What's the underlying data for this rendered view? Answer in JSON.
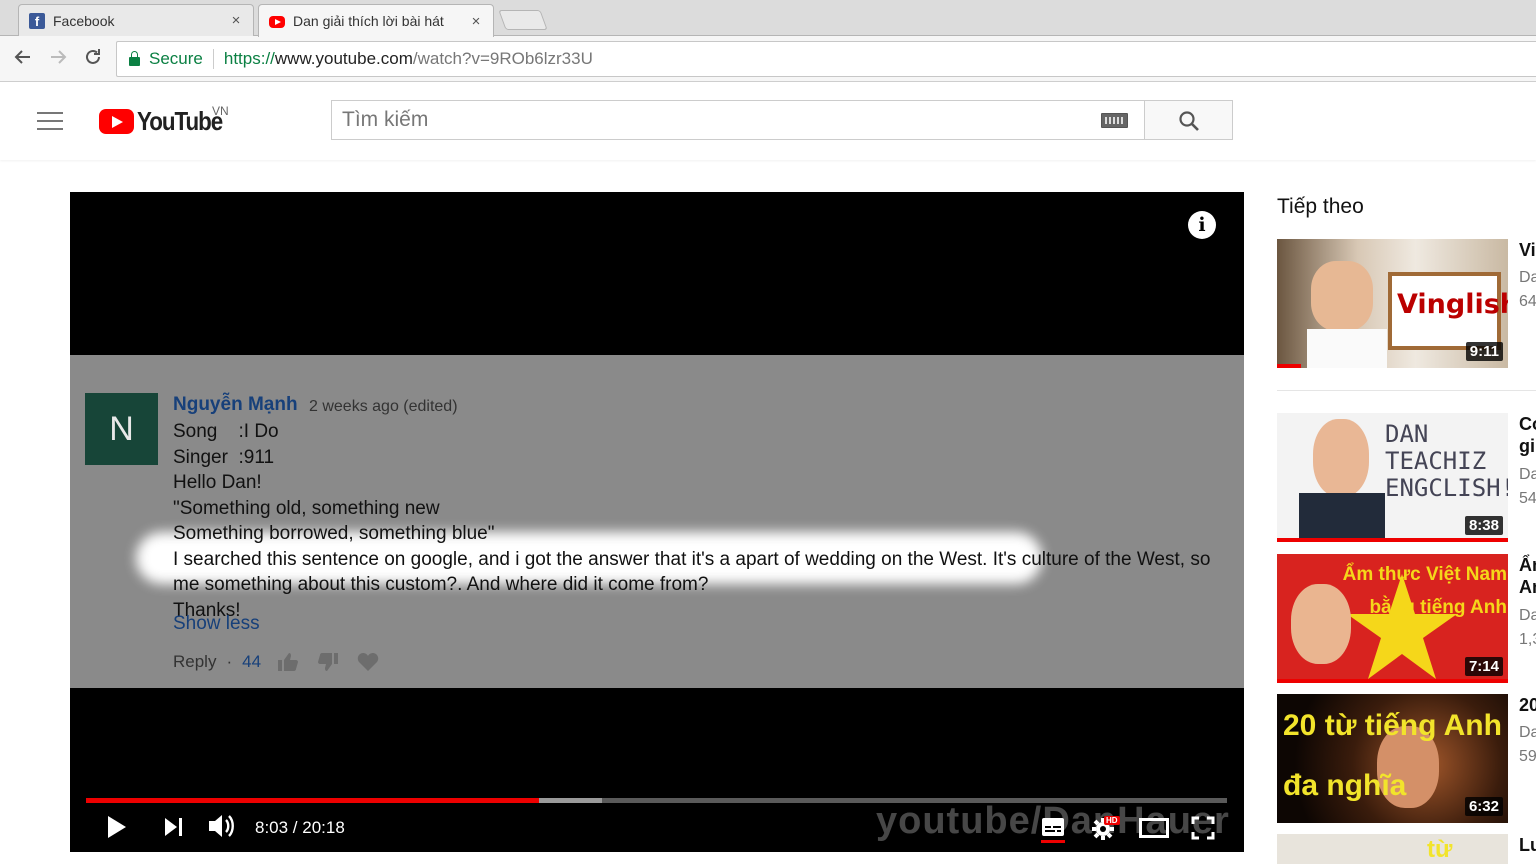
{
  "browser": {
    "tabs": [
      {
        "title": "Facebook",
        "icon": "facebook-icon",
        "active": false
      },
      {
        "title": "Dan giải thích lời bài hát",
        "icon": "youtube-icon",
        "active": true
      }
    ],
    "close_glyph": "×",
    "secure_label": "Secure",
    "url_scheme": "https://",
    "url_host": "www.youtube.com",
    "url_path": "/watch?v=9ROb6lzr33U"
  },
  "header": {
    "logo_text": "YouTube",
    "country": "VN",
    "search_placeholder": "Tìm kiếm"
  },
  "player": {
    "comment": {
      "avatar_letter": "N",
      "author": "Nguyễn Mạnh",
      "time": "2 weeks ago (edited)",
      "lines": [
        "Song    :I Do",
        "Singer  :911",
        "Hello Dan!",
        "\"Something old, something new",
        "Something borrowed, something blue\"",
        "I searched this sentence on google, and i got the answer that it's a apart of wedding on the West. It's culture of the West, so",
        "me something about this custom?. And where did it come from?",
        "Thanks!"
      ],
      "show_less": "Show less",
      "reply": "Reply",
      "dot": "·",
      "likes": "44"
    },
    "time_display": "8:03 / 20:18",
    "progress_played": 0.397,
    "progress_loaded": 0.452,
    "watermark": "youtube/DanHauer",
    "hd_badge": "HD",
    "info_glyph": "i"
  },
  "sidebar": {
    "up_next": "Tiếp theo",
    "items": [
      {
        "title": "Vi",
        "channel": "Da",
        "views": "64",
        "duration": "9:11",
        "thumb_text": "Vinglish"
      },
      {
        "title": "Co",
        "title2": "gi",
        "channel": "Da",
        "views": "54",
        "duration": "8:38",
        "thumb_text": "DAN TEACHIZ ENGCLISH!"
      },
      {
        "title": "Ẩn",
        "title2": "An",
        "channel": "Da",
        "views": "1,3",
        "duration": "7:14",
        "thumb_text": "Ẩm thực Việt Nam bằng tiếng Anh"
      },
      {
        "title": "20",
        "channel": "Da",
        "views": "59",
        "duration": "6:32",
        "thumb_text": "20 từ tiếng Anh đa nghĩa"
      },
      {
        "title": "Lu",
        "duration": "",
        "thumb_text": "từ"
      }
    ]
  },
  "colors": {
    "youtube_red": "#ff0000",
    "link_blue": "#17407a",
    "secure_green": "#0b8043"
  }
}
